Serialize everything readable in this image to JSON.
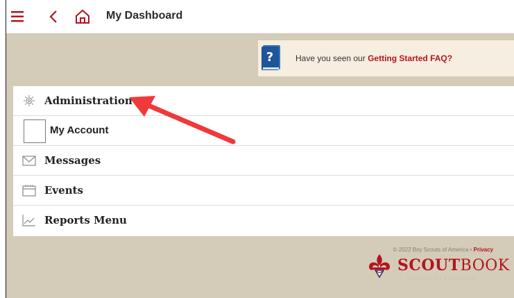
{
  "header": {
    "title": "My Dashboard",
    "menu_icon": "hamburger-menu-icon",
    "back_icon": "chevron-left-icon",
    "home_icon": "home-icon"
  },
  "faq_banner": {
    "text": "Have you seen our",
    "link": "Getting Started FAQ?",
    "icon": "question-book-icon"
  },
  "menu": {
    "items": [
      {
        "label": "Administration",
        "icon": "gear-icon"
      },
      {
        "label": "My Account",
        "icon": "avatar-placeholder"
      },
      {
        "label": "Messages",
        "icon": "envelope-icon"
      },
      {
        "label": "Events",
        "icon": "calendar-icon"
      },
      {
        "label": "Reports Menu",
        "icon": "chart-line-icon"
      }
    ]
  },
  "footer": {
    "copyright": "© 2022 Boy Scouts of America",
    "separator": " • ",
    "privacy": "Privacy",
    "brand_bold": "SCOUT",
    "brand_light": "BOOK",
    "tagline": "POWERED BY SCOUTBOOK"
  },
  "colors": {
    "brand_red": "#b3141d",
    "page_background": "#d4cbb8",
    "annotation_arrow": "#f0393a"
  }
}
